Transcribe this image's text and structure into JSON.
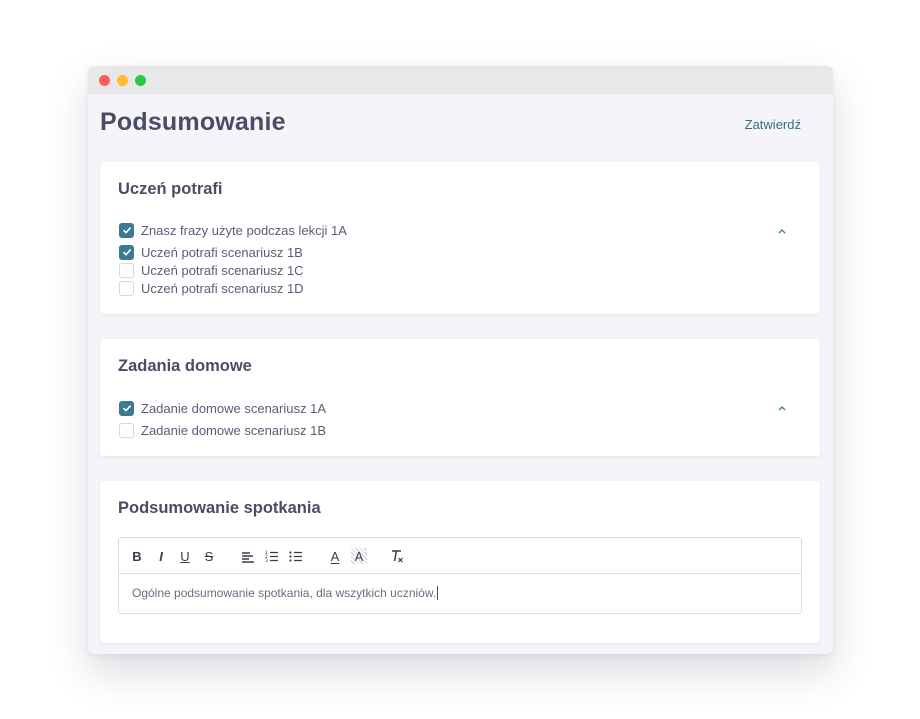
{
  "header": {
    "title": "Podsumowanie",
    "confirm_label": "Zatwierdź"
  },
  "skills": {
    "title": "Uczeń potrafi",
    "items": [
      {
        "label": "Znasz frazy użyte podczas lekcji 1A",
        "checked": true
      },
      {
        "label": "Uczeń potrafi scenariusz 1B",
        "checked": true
      },
      {
        "label": "Uczeń potrafi scenariusz 1C",
        "checked": false
      },
      {
        "label": "Uczeń potrafi scenariusz 1D",
        "checked": false
      }
    ]
  },
  "homework": {
    "title": "Zadania domowe",
    "items": [
      {
        "label": "Zadanie domowe scenariusz 1A",
        "checked": true
      },
      {
        "label": "Zadanie domowe scenariusz 1B",
        "checked": false
      }
    ]
  },
  "summary": {
    "title": "Podsumowanie spotkania",
    "toolbar": {
      "bold": "B",
      "italic": "I",
      "underline": "U",
      "strike": "S",
      "font_color": "A",
      "bg_color": "A"
    },
    "text": "Ogólne podsumowanie spotkania, dla wszytkich uczniów."
  },
  "colors": {
    "accent": "#3a7a92",
    "link": "#2f6f86",
    "background": "#f4f4f9"
  },
  "icons": {
    "check": "check-icon",
    "collapse": "chevron-up-icon"
  }
}
